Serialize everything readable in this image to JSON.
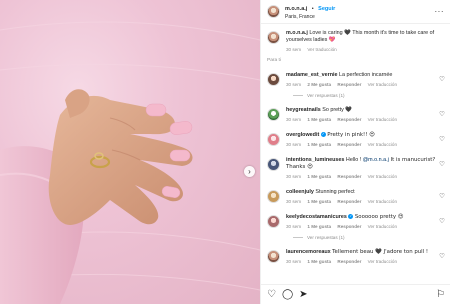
{
  "post": {
    "username": "m.o.n.a.j",
    "separator": "•",
    "follow_label": "Seguir",
    "location": "Paris, France",
    "more_label": "···",
    "caption_text": "Love is caring 🖤 This month it's time to take care of yourselves ladies 💖",
    "caption_meta_time": "30 sem",
    "caption_meta_translate": "Ver traducción",
    "paragraph_label": "Para ti"
  },
  "comments": [
    {
      "user": "madame_est_vernie",
      "text": "La perfection incarnée",
      "time": "30 sem",
      "likes": "2 Me gusta",
      "reply": "Responder",
      "translate": "Ver traducción"
    },
    {
      "user": "heygreatnails",
      "text": "So pretty 🖤",
      "time": "30 sem",
      "likes": "1 Me gusta",
      "reply": "Responder",
      "translate": "Ver traducción"
    },
    {
      "user": "overglowedit",
      "text": "Pretty in pink!! 😍",
      "time": "30 sem",
      "likes": "1 Me gusta",
      "reply": "Responder",
      "translate": "Ver traducción"
    },
    {
      "user": "intentions_lumineuses",
      "text_before": "Hello ! ",
      "mention": "@m.o.n.a.j",
      "text_after": " It is manucurist? Thanks 😍",
      "time": "30 sem",
      "likes": "1 Me gusta",
      "reply": "Responder",
      "translate": "Ver traducción"
    },
    {
      "user": "colleenjuly",
      "text": "Stunning perfect",
      "time": "30 sem",
      "likes": "1 Me gusta",
      "reply": "Responder",
      "translate": "Ver traducción"
    },
    {
      "user": "keelydecostamanicures",
      "text": "Soooooo pretty 😍",
      "time": "30 sem",
      "likes": "1 Me gusta",
      "reply": "Responder",
      "translate": "Ver traducción"
    },
    {
      "user": "laurencemoreaux",
      "text": "Tellement beau 🖤 J'adore ton pull !",
      "time": "30 sem",
      "likes": "1 Me gusta",
      "reply": "Responder",
      "translate": "Ver traducción"
    }
  ],
  "replies": [
    {
      "label": "Ver respuestas (1)"
    },
    {
      "label": "Ver respuestas (1)"
    }
  ],
  "icons": {
    "next": "chevron-right-icon",
    "heart": "heart-icon",
    "comment": "comment-icon",
    "share": "share-icon",
    "save": "bookmark-icon"
  },
  "colors": {
    "accent": "#0095f6",
    "sweater": "#eec3d5",
    "nail": "#f4b9cc"
  }
}
